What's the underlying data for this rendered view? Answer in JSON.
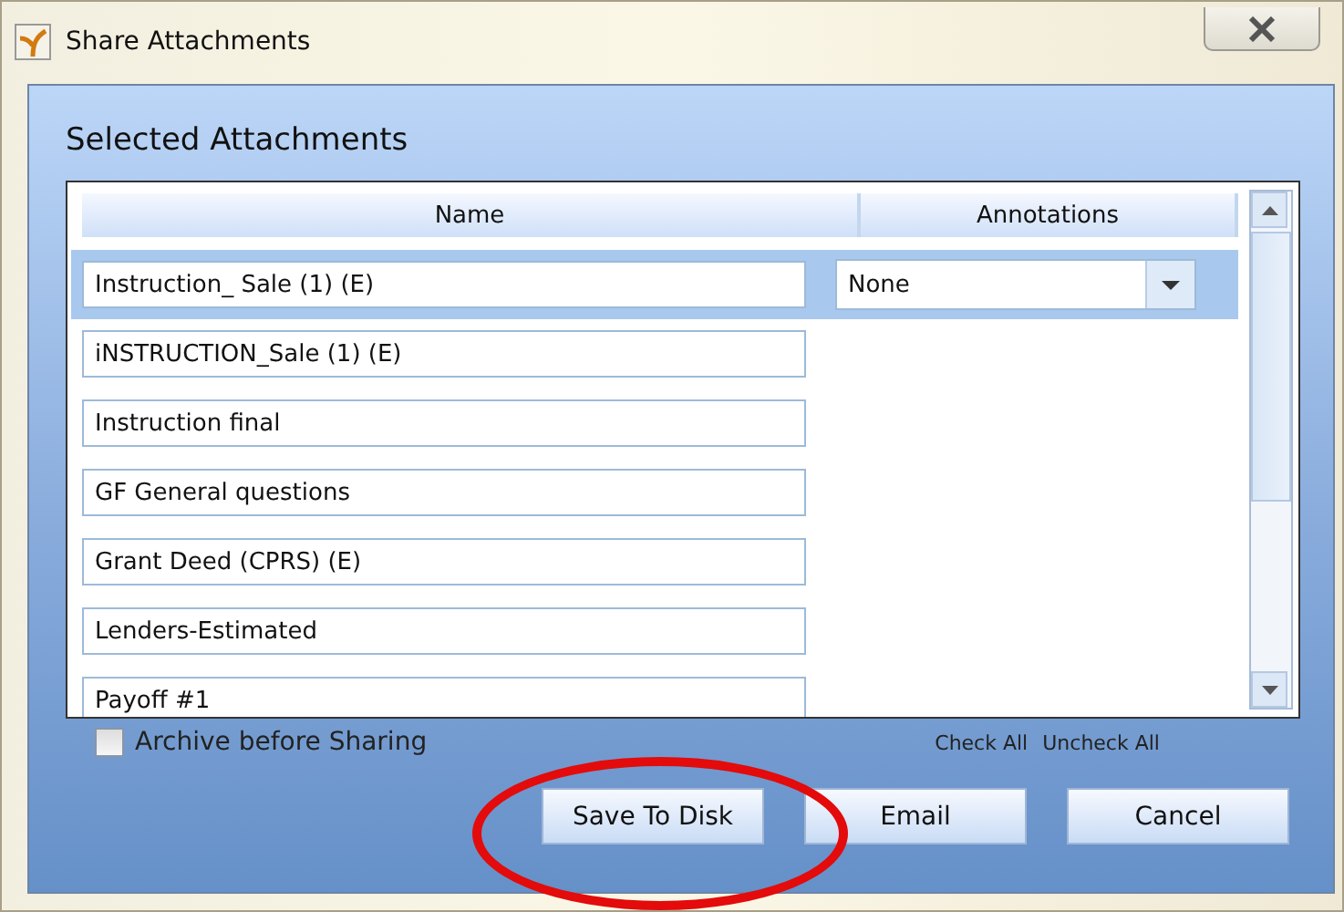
{
  "window": {
    "title": "Share Attachments"
  },
  "heading": "Selected Attachments",
  "table": {
    "columns": [
      "Name",
      "Annotations"
    ],
    "rows": [
      {
        "name": "Instruction_ Sale (1) (E)",
        "selected": true,
        "annotation": "None"
      },
      {
        "name": "iNSTRUCTION_Sale (1) (E)",
        "selected": false
      },
      {
        "name": "Instruction final",
        "selected": false
      },
      {
        "name": "GF General questions",
        "selected": false
      },
      {
        "name": "Grant Deed (CPRS) (E)",
        "selected": false
      },
      {
        "name": "Lenders-Estimated",
        "selected": false
      },
      {
        "name": "Payoff #1",
        "selected": false
      }
    ]
  },
  "archive": {
    "label": "Archive before Sharing",
    "checked": false
  },
  "links": [
    "Check All",
    "Uncheck All"
  ],
  "buttons": [
    "Save To Disk",
    "Email",
    "Cancel"
  ]
}
